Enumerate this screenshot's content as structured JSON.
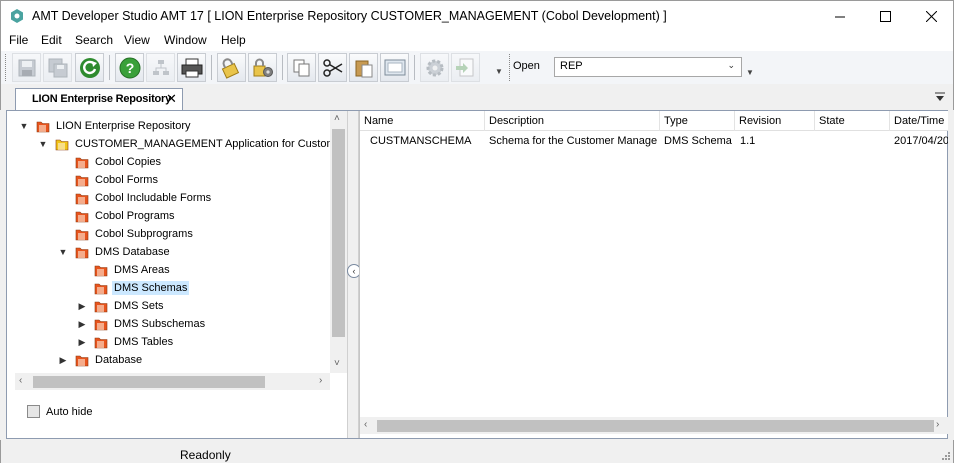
{
  "window": {
    "title": "AMT Developer Studio AMT 17  [ LION Enterprise Repository CUSTOMER_MANAGEMENT (Cobol Development) ]",
    "minimize_icon": "minimize-icon",
    "maximize_icon": "maximize-icon",
    "close_icon": "close-icon"
  },
  "menu": [
    "File",
    "Edit",
    "Search",
    "View",
    "Window",
    "Help"
  ],
  "toolbar": {
    "buttons": [
      {
        "icon": "save-icon",
        "enabled": false
      },
      {
        "icon": "save-all-icon",
        "enabled": false
      },
      {
        "icon": "refresh-icon",
        "enabled": true
      },
      {
        "icon": "help-icon",
        "enabled": true
      },
      {
        "icon": "tree-icon",
        "enabled": false
      },
      {
        "icon": "print-icon",
        "enabled": true
      },
      {
        "icon": "lock-icon",
        "enabled": true
      },
      {
        "icon": "settings-lock-icon",
        "enabled": true
      },
      {
        "icon": "copy-icon",
        "enabled": true
      },
      {
        "icon": "cut-icon",
        "enabled": true
      },
      {
        "icon": "paste-icon",
        "enabled": true
      },
      {
        "icon": "screen-icon",
        "enabled": true
      },
      {
        "icon": "gear-icon",
        "enabled": false
      },
      {
        "icon": "pdf-export-icon",
        "enabled": false
      }
    ],
    "open_label": "Open",
    "open_value": "REP"
  },
  "tab": {
    "label": "LION Enterprise Repository",
    "close_glyph": "✕"
  },
  "tree": {
    "items": [
      {
        "label": "LION Enterprise Repository",
        "level": 0,
        "expander": "▼",
        "folder_color": "#e8541d"
      },
      {
        "label": "CUSTOMER_MANAGEMENT Application for Customer",
        "level": 1,
        "expander": "▼",
        "folder_color": "#f0c419"
      },
      {
        "label": "Cobol Copies",
        "level": 2,
        "expander": "",
        "folder_color": "#e8541d"
      },
      {
        "label": "Cobol Forms",
        "level": 2,
        "expander": "",
        "folder_color": "#e8541d"
      },
      {
        "label": "Cobol Includable Forms",
        "level": 2,
        "expander": "",
        "folder_color": "#e8541d"
      },
      {
        "label": "Cobol Programs",
        "level": 2,
        "expander": "",
        "folder_color": "#e8541d"
      },
      {
        "label": "Cobol Subprograms",
        "level": 2,
        "expander": "",
        "folder_color": "#e8541d"
      },
      {
        "label": "DMS Database",
        "level": 2,
        "expander": "▼",
        "folder_color": "#e8541d"
      },
      {
        "label": "DMS Areas",
        "level": 3,
        "expander": "",
        "folder_color": "#e8541d"
      },
      {
        "label": "DMS Schemas",
        "level": 3,
        "expander": "",
        "folder_color": "#e8541d",
        "selected": true
      },
      {
        "label": "DMS Sets",
        "level": 3,
        "expander": "▶",
        "folder_color": "#e8541d"
      },
      {
        "label": "DMS Subschemas",
        "level": 3,
        "expander": "▶",
        "folder_color": "#e8541d"
      },
      {
        "label": "DMS Tables",
        "level": 3,
        "expander": "▶",
        "folder_color": "#e8541d"
      },
      {
        "label": "Database",
        "level": 2,
        "expander": "▶",
        "folder_color": "#e8541d"
      }
    ]
  },
  "autohide_label": "Auto hide",
  "grid": {
    "columns": [
      "Name",
      "Description",
      "Type",
      "Revision",
      "State",
      "Date/Time"
    ],
    "rows": [
      [
        "CUSTMANSCHEMA",
        "Schema for the Customer Manageme",
        "DMS Schema",
        "1.1",
        "",
        "2017/04/20"
      ]
    ]
  },
  "status": {
    "text": "Readonly"
  }
}
